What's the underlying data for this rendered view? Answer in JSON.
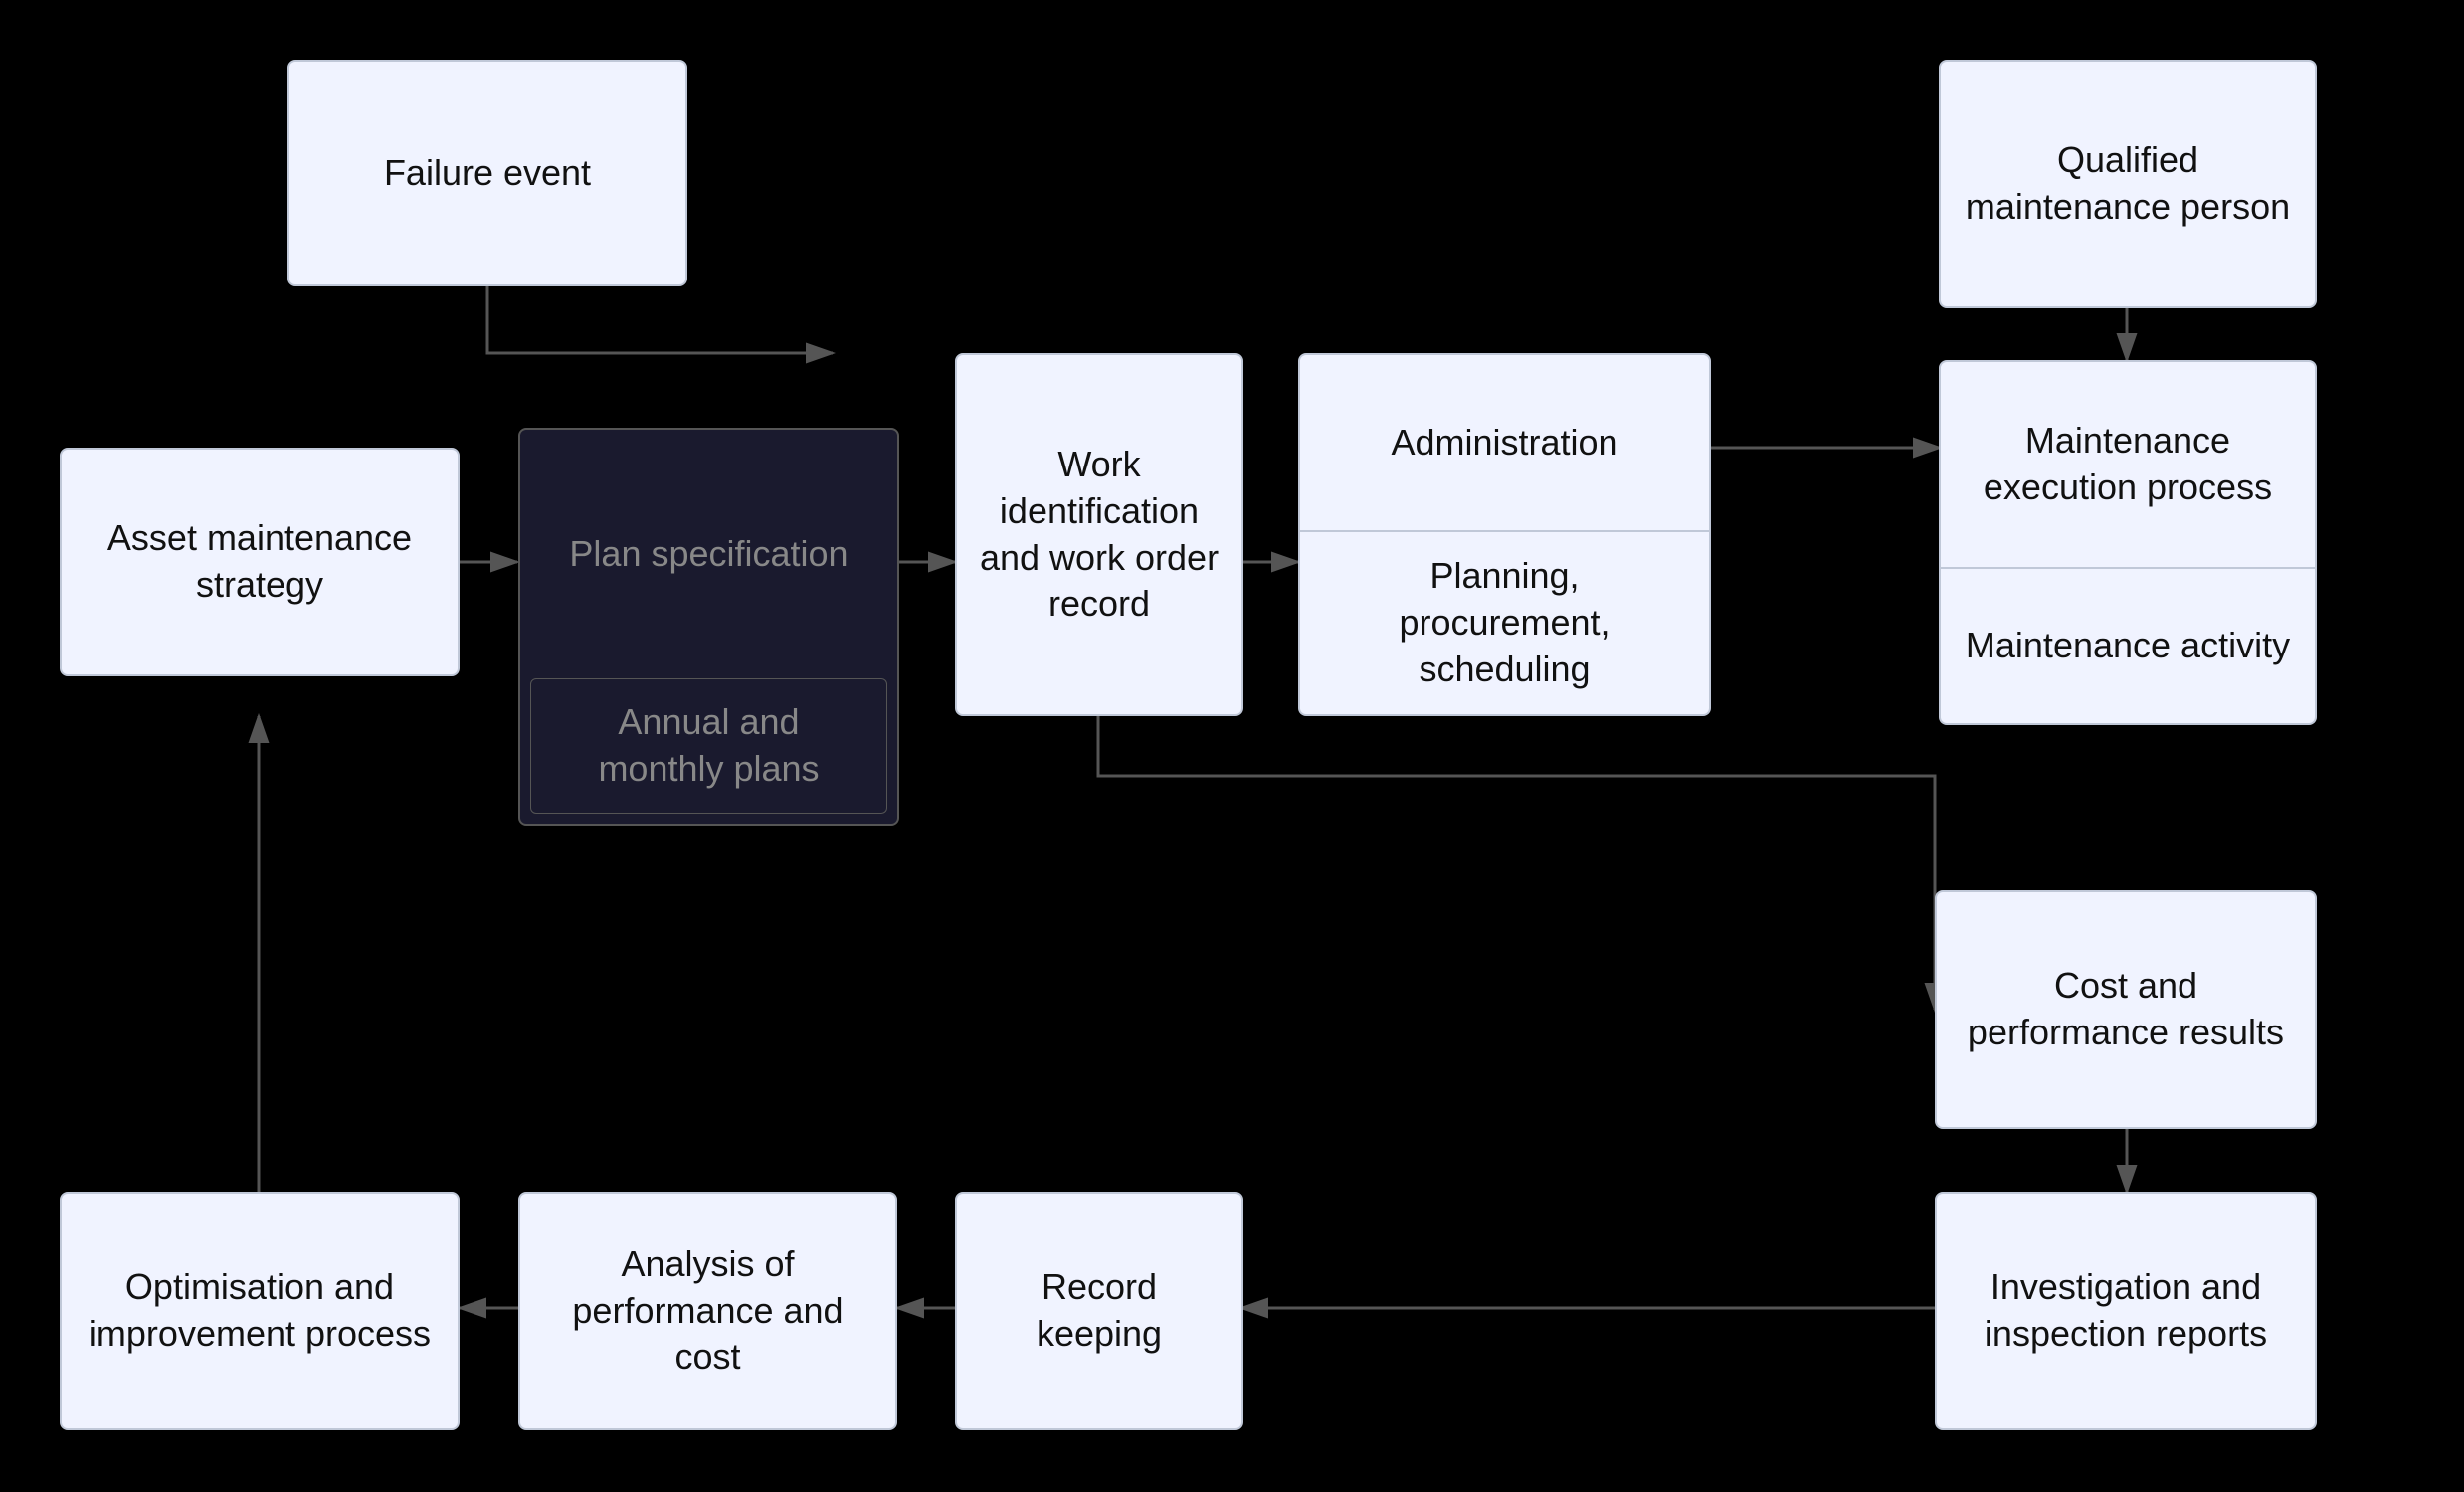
{
  "boxes": {
    "failure_event": "Failure event",
    "qualified_maintenance": "Qualified maintenance person",
    "asset_maintenance": "Asset maintenance strategy",
    "plan_specification": "Plan specification",
    "annual_monthly": "Annual and monthly plans",
    "work_identification": "Work identification and work order record",
    "administration": "Administration",
    "planning": "Planning, procurement, scheduling",
    "maintenance_execution": "Maintenance execution process",
    "maintenance_activity": "Maintenance activity",
    "cost_performance": "Cost and performance results",
    "optimisation": "Optimisation and improvement process",
    "analysis": "Analysis of performance and cost",
    "record_keeping": "Record keeping",
    "investigation": "Investigation and inspection reports"
  }
}
